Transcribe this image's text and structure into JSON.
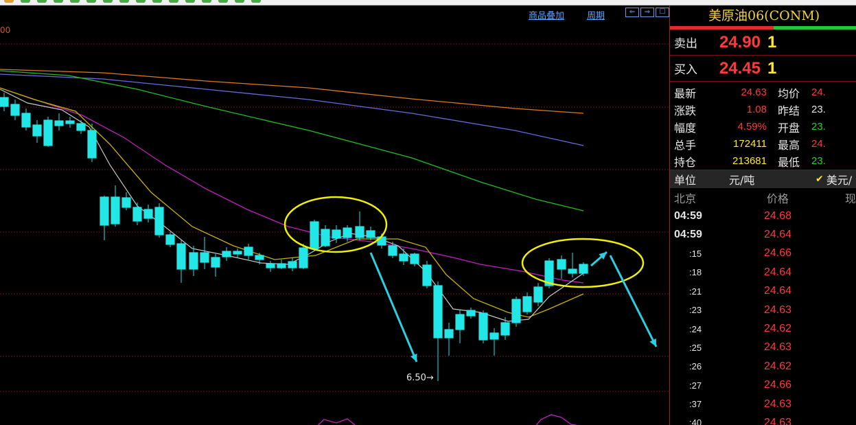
{
  "toolbar": {
    "icon_colors": [
      "#e0a030",
      "#4aa84a",
      "#4aa84a",
      "#4aa84a",
      "#4aa84a",
      "#4aa84a",
      "#4aa84a",
      "#4aa84a",
      "#4aa84a",
      "#4aa84a",
      "#4aa84a",
      "#4aa84a",
      "#4aa84a",
      "#4aa84a",
      "#4aa84a",
      "#4aa84a"
    ]
  },
  "chart_header": {
    "overlay_link": "商品叠加",
    "period_link": "周期",
    "nav_buttons": [
      "⇐",
      "⇒",
      "☐"
    ],
    "price_axis_fragment": "00"
  },
  "chart_annotations": {
    "low_price_label": "6.50→"
  },
  "colors": {
    "bg": "#000000",
    "grid": "#7a0f16",
    "candle_up": "#e23b3b",
    "candle_down": "#23e6e6",
    "ma_white": "#c8c8c8",
    "ma_yellow": "#c8b400",
    "ma_magenta": "#c020c0",
    "ma_green": "#20c020",
    "ma_blue": "#6a6ae0",
    "ma_orange": "#e07a20",
    "circle": "#f0f000",
    "arrow": "#2bd0e0"
  },
  "chart_data": {
    "type": "candlestick",
    "price_top_label_fragment": "00",
    "lowest_marked_value": 6.5,
    "candles": [
      {
        "o": 0,
        "c": 0,
        "h": 0,
        "l": 0
      }
    ]
  },
  "panel": {
    "title": "美原油06(CONM)",
    "sell": {
      "label": "卖出",
      "price": "24.90",
      "volume": "1"
    },
    "buy": {
      "label": "买入",
      "price": "24.45",
      "volume": "1"
    },
    "stats": [
      {
        "l1": "最新",
        "v1": "24.63",
        "c1": "red",
        "l2": "均价",
        "v2": "24.",
        "c2": "red"
      },
      {
        "l1": "涨跌",
        "v1": "1.08",
        "c1": "red",
        "l2": "昨结",
        "v2": "23.",
        "c2": "white"
      },
      {
        "l1": "幅度",
        "v1": "4.59%",
        "c1": "red",
        "l2": "开盘",
        "v2": "23.",
        "c2": "green"
      },
      {
        "l1": "总手",
        "v1": "172411",
        "c1": "yellow",
        "l2": "最高",
        "v2": "24.",
        "c2": "red"
      },
      {
        "l1": "持仓",
        "v1": "213681",
        "c1": "yellow",
        "l2": "最低",
        "v2": "23.",
        "c2": "green"
      }
    ],
    "unit": {
      "label": "单位",
      "value": "元/吨",
      "check": "✔",
      "currency": "美元/"
    },
    "tick_header": {
      "time": "北京",
      "price": "价格",
      "volume": "现"
    },
    "ticks": [
      {
        "time": "04:59",
        "price": "24.68",
        "style": "bold"
      },
      {
        "time": "04:59",
        "price": "24.64",
        "style": "bold"
      },
      {
        "time": ":15",
        "price": "24.66",
        "style": "sub"
      },
      {
        "time": ":18",
        "price": "24.64",
        "style": "sub"
      },
      {
        "time": ":21",
        "price": "24.64",
        "style": "sub"
      },
      {
        "time": ":23",
        "price": "24.63",
        "style": "sub"
      },
      {
        "time": ":24",
        "price": "24.62",
        "style": "sub"
      },
      {
        "time": ":25",
        "price": "24.63",
        "style": "sub"
      },
      {
        "time": ":26",
        "price": "24.62",
        "style": "sub"
      },
      {
        "time": ":27",
        "price": "24.66",
        "style": "sub"
      },
      {
        "time": ":37",
        "price": "24.63",
        "style": "sub"
      },
      {
        "time": ":40",
        "price": "24.63",
        "style": "sub"
      }
    ]
  }
}
